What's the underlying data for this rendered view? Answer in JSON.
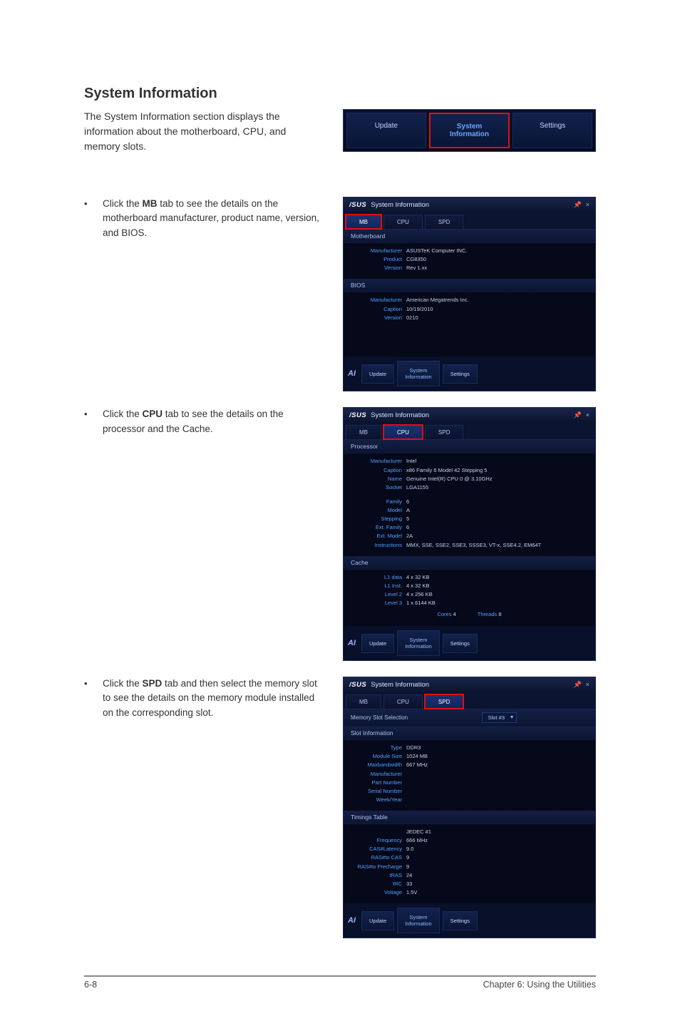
{
  "heading": "System Information",
  "intro": "The System Information section displays the information about the motherboard, CPU, and memory slots.",
  "topnav": {
    "update": "Update",
    "sysinfo_l1": "System",
    "sysinfo_l2": "Information",
    "settings": "Settings"
  },
  "bullets": {
    "mb_pre": "Click the ",
    "mb_strong": "MB",
    "mb_post": " tab to see the details on the motherboard manufacturer, product name, version, and BIOS.",
    "cpu_pre": "Click the ",
    "cpu_strong": "CPU",
    "cpu_post": " tab to see the details on the processor and the Cache.",
    "spd_pre": "Click the ",
    "spd_strong": "SPD",
    "spd_post": " tab and then select the memory slot to see the details on the memory module installed on the corresponding slot."
  },
  "app": {
    "logo": "/SUS",
    "title": "System Information",
    "pin": "📌",
    "close": "×",
    "tabs": {
      "mb": "MB",
      "cpu": "CPU",
      "spd": "SPD"
    },
    "footer_logo": "AI",
    "footer": {
      "update": "Update",
      "sysinfo_l1": "System",
      "sysinfo_l2": "Information",
      "settings": "Settings"
    }
  },
  "mb_panel": {
    "section1": "Motherboard",
    "rows1": [
      {
        "k": "Manufacturer",
        "v": "ASUSTeK Computer INC."
      },
      {
        "k": "Product",
        "v": "CG8350"
      },
      {
        "k": "Version",
        "v": "Rev 1.xx"
      }
    ],
    "section2": "BIOS",
    "rows2": [
      {
        "k": "Manufacturer",
        "v": "American Megatrends Inc."
      },
      {
        "k": "Caption",
        "v": "10/19/2010"
      },
      {
        "k": "Version",
        "v": "0210"
      }
    ]
  },
  "cpu_panel": {
    "section1": "Processor",
    "rows1": [
      {
        "k": "Manufacturer",
        "v": "Intel"
      },
      {
        "k": "Caption",
        "v": "x86 Family 6 Model 42 Stepping 5"
      },
      {
        "k": "Name",
        "v": "Genuine Intel(R) CPU 0 @ 3.10GHz"
      },
      {
        "k": "Socket",
        "v": "LGA1155"
      }
    ],
    "rows1b": [
      {
        "k": "Family",
        "v": "6"
      },
      {
        "k": "Model",
        "v": "A"
      },
      {
        "k": "Stepping",
        "v": "5"
      },
      {
        "k": "Ext. Family",
        "v": "6"
      },
      {
        "k": "Ext. Model",
        "v": "2A"
      },
      {
        "k": "Instructions",
        "v": "MMX, SSE, SSE2, SSE3, SSSE3, VT-x, SSE4.2, EM64T"
      }
    ],
    "section2": "Cache",
    "rows2": [
      {
        "k": "L1 data",
        "v": "4 x 32 KB"
      },
      {
        "k": "L1 Inst.",
        "v": "4 x 32 KB"
      },
      {
        "k": "Level 2",
        "v": "4 x 256 KB"
      },
      {
        "k": "Level 3",
        "v": "1 x 6144 KB"
      }
    ],
    "cores_lbl": "Cores",
    "cores_v": "4",
    "threads_lbl": "Threads",
    "threads_v": "8"
  },
  "spd_panel": {
    "slot_label": "Memory Slot Selection",
    "slot_value": "Slot #3",
    "section1": "Slot Information",
    "rows1": [
      {
        "k": "Type",
        "v": "DDR3"
      },
      {
        "k": "Module Size",
        "v": "1024 MB"
      },
      {
        "k": "Maxbandwidth",
        "v": "667 MHz"
      },
      {
        "k": "Manufacturer",
        "v": ""
      },
      {
        "k": "Part Number",
        "v": ""
      },
      {
        "k": "Serial Number",
        "v": ""
      },
      {
        "k": "Week/Year",
        "v": ""
      }
    ],
    "section2": "Timings Table",
    "rows2": [
      {
        "k": "",
        "v": "JEDEC #1"
      },
      {
        "k": "Frequency",
        "v": "666 MHz"
      },
      {
        "k": "CAS#Latency",
        "v": "9.0"
      },
      {
        "k": "RAS#to CAS",
        "v": "9"
      },
      {
        "k": "RAS#to Precharge",
        "v": "9"
      },
      {
        "k": "tRAS",
        "v": "24"
      },
      {
        "k": "tRC",
        "v": "33"
      },
      {
        "k": "Voltage",
        "v": "1.5V"
      }
    ]
  },
  "footer": {
    "left": "6-8",
    "right": "Chapter 6: Using the Utilities"
  }
}
